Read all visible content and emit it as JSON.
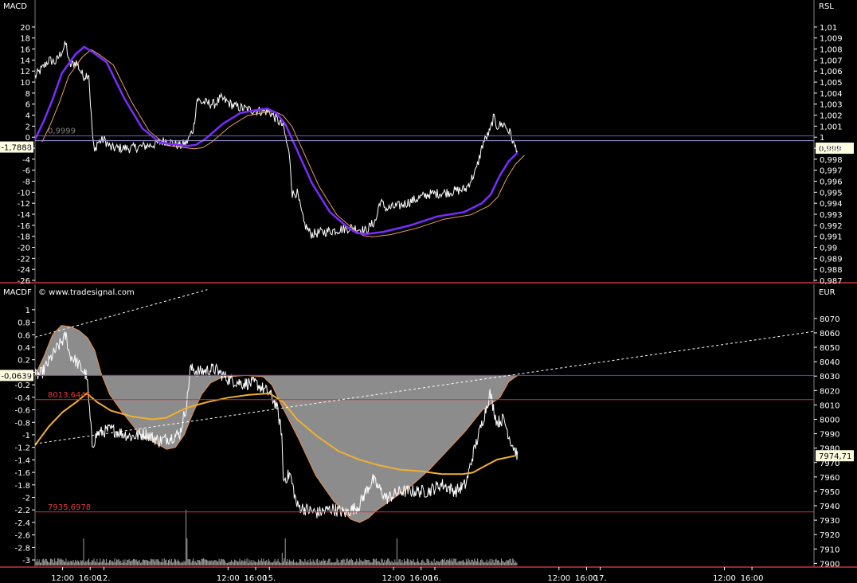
{
  "chart_data": [
    {
      "type": "line",
      "panel": "top",
      "title": "MACD",
      "right_axis_title": "RSL",
      "left_ticks": [
        "20",
        "18",
        "16",
        "14",
        "12",
        "10",
        "8",
        "6",
        "4",
        "2",
        "0",
        "-2",
        "-4",
        "-6",
        "-8",
        "-10",
        "-12",
        "-14",
        "-16",
        "-18",
        "-20",
        "-22",
        "-24",
        "-26"
      ],
      "right_ticks": [
        "1,01",
        "1,009",
        "1,008",
        "1,007",
        "1,006",
        "1,005",
        "1,004",
        "1,003",
        "1,002",
        "1,001",
        "1",
        "0,999",
        "0,998",
        "0,997",
        "0,996",
        "0,995",
        "0,994",
        "0,993",
        "0,992",
        "0,991",
        "0,99",
        "0,989",
        "0,988",
        "0,987"
      ],
      "ylim_left": [
        -26,
        21
      ],
      "ylim_right": [
        0.987,
        1.0105
      ],
      "reference_label": "0,9999",
      "reference_value": 0.9999,
      "left_marker": "-1,7888",
      "left_marker_value": -1.7888,
      "right_marker": "0,999",
      "right_marker_value": 0.999,
      "colors": {
        "rsl": "#ffffff",
        "macd": "#7a2cff",
        "signal": "#e8a060",
        "reference": "#6a5acd"
      }
    },
    {
      "type": "area",
      "panel": "bottom",
      "title": "MACDF",
      "right_axis_title": "EUR",
      "watermark": "© www.tradesignal.com",
      "left_ticks": [
        "1",
        "0.8",
        "0.6",
        "0.4",
        "0.2",
        "0",
        "-0.2",
        "-0.4",
        "-0.6",
        "-0.8",
        "-1",
        "-1.2",
        "-1.4",
        "-1.6",
        "-1.8",
        "-2",
        "-2.2",
        "-2.4",
        "-2.6",
        "-2.8",
        "-3"
      ],
      "right_ticks": [
        "8070",
        "8060",
        "8050",
        "8040",
        "8030",
        "8020",
        "8010",
        "8000",
        "7990",
        "7980",
        "7970",
        "7960",
        "7950",
        "7940",
        "7930",
        "7920",
        "7910",
        "7900"
      ],
      "ylim_left": [
        -3.05,
        1.1
      ],
      "ylim_right": [
        7898,
        8076
      ],
      "left_marker": "-0,0639",
      "left_marker_value": -0.0639,
      "right_marker": "7974,71",
      "right_marker_value": 7974.71,
      "resistance_label": "8013,6445",
      "resistance_value": 8013.6445,
      "support_label": "7935,6978",
      "support_value": 7935.6978,
      "colors": {
        "price": "#ffffff",
        "area": "#8c8c8c",
        "ma": "#f0b030",
        "levels": "#c8323c"
      }
    }
  ],
  "x_axis": {
    "labels": [
      "12:00",
      "16:00",
      "12.",
      "12:00",
      "16:00",
      "15.",
      "12:00",
      "16:00",
      "16.",
      "12:00",
      "16:00",
      "17.",
      "12:00",
      "16:00"
    ],
    "values": [
      13,
      17,
      19,
      37,
      41,
      43,
      61,
      65,
      67,
      85,
      89,
      91,
      109,
      113
    ],
    "range": [
      9,
      122
    ]
  }
}
